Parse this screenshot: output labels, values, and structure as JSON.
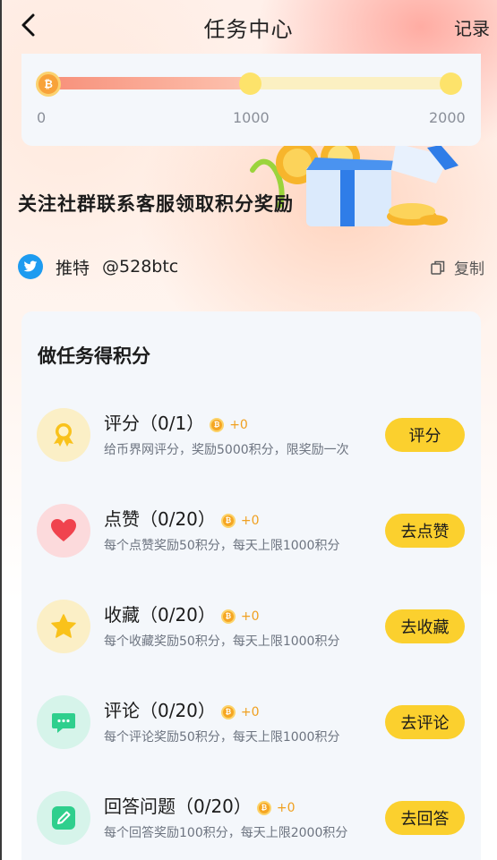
{
  "header": {
    "back_icon": "chevron-left-icon",
    "title": "任务中心",
    "records_label": "记录"
  },
  "progress": {
    "current_points": 0,
    "fill_fraction": 0.5,
    "ticks": [
      "0",
      "1000",
      "2000"
    ],
    "colors": {
      "fill_start": "#f7907a",
      "track": "#fbf0c2",
      "node": "#fde36b"
    }
  },
  "promo": {
    "title": "关注社群联系客服领取积分奖励",
    "twitter_label": "推特",
    "twitter_handle": "@528btc",
    "copy_label": "复制"
  },
  "tasks_section": {
    "title": "做任务得积分",
    "items": [
      {
        "name": "评分（0/1）",
        "bonus": "+0",
        "desc": "给币界网评分，奖励5000积分，限奖励一次",
        "button": "评分",
        "icon": "award-ribbon-icon",
        "icon_bg": "#fbefc6"
      },
      {
        "name": "点赞（0/20）",
        "bonus": "+0",
        "desc": "每个点赞奖励50积分，每天上限1000积分",
        "button": "去点赞",
        "icon": "heart-icon",
        "icon_bg": "#fcdadc"
      },
      {
        "name": "收藏（0/20）",
        "bonus": "+0",
        "desc": "每个收藏奖励50积分，每天上限1000积分",
        "button": "去收藏",
        "icon": "star-icon",
        "icon_bg": "#fbefc6"
      },
      {
        "name": "评论（0/20）",
        "bonus": "+0",
        "desc": "每个评论奖励50积分，每天上限1000积分",
        "button": "去评论",
        "icon": "comment-icon",
        "icon_bg": "#d6f4ea"
      },
      {
        "name": "回答问题（0/20）",
        "bonus": "+0",
        "desc": "每个回答奖励100积分，每天上限2000积分",
        "button": "去回答",
        "icon": "edit-icon",
        "icon_bg": "#d6f4ea"
      }
    ]
  }
}
